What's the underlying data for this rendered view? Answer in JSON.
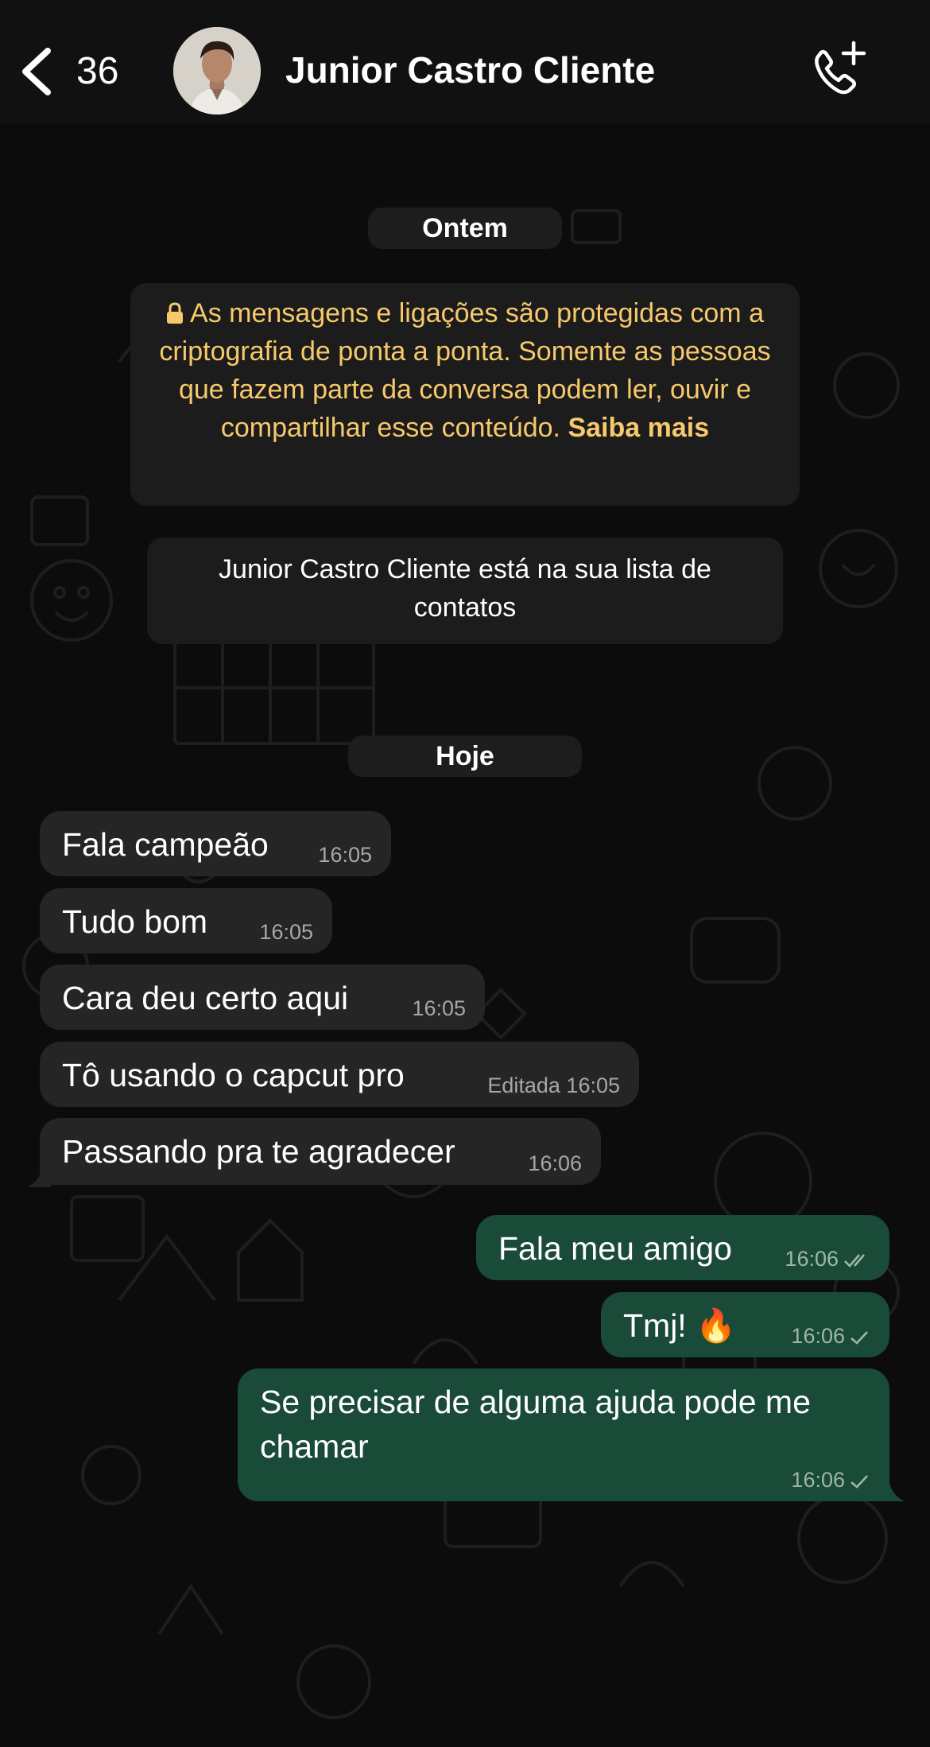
{
  "header": {
    "back_count": "36",
    "contact_name": "Junior Castro Cliente"
  },
  "chat": {
    "date_yesterday": "Ontem",
    "encryption_notice": "As mensagens e ligações são protegidas com a criptografia de ponta a ponta. Somente as pessoas que fazem parte da conversa podem ler, ouvir e compartilhar esse conteúdo.",
    "encryption_link": "Saiba mais",
    "contact_notice": "Junior Castro Cliente está na sua lista de contatos",
    "date_today": "Hoje",
    "messages": [
      {
        "text": "Fala campeão",
        "time": "16:05",
        "dir": "in"
      },
      {
        "text": "Tudo bom",
        "time": "16:05",
        "dir": "in"
      },
      {
        "text": "Cara deu certo aqui",
        "time": "16:05",
        "dir": "in"
      },
      {
        "text": "Tô usando o capcut pro",
        "time": "Editada 16:05",
        "dir": "in"
      },
      {
        "text": "Passando pra te agradecer",
        "time": "16:06",
        "dir": "in"
      },
      {
        "text": "Fala meu amigo",
        "time": "16:06",
        "dir": "out",
        "status": "read"
      },
      {
        "text": "Tmj! 🔥",
        "time": "16:06",
        "dir": "out",
        "status": "sent"
      },
      {
        "text": "Se precisar de alguma ajuda pode me chamar",
        "time": "16:06",
        "dir": "out",
        "status": "sent"
      }
    ]
  },
  "colors": {
    "incoming_bubble": "#252525",
    "outgoing_bubble": "#1a4a38",
    "encryption_text": "#f7c96b"
  }
}
